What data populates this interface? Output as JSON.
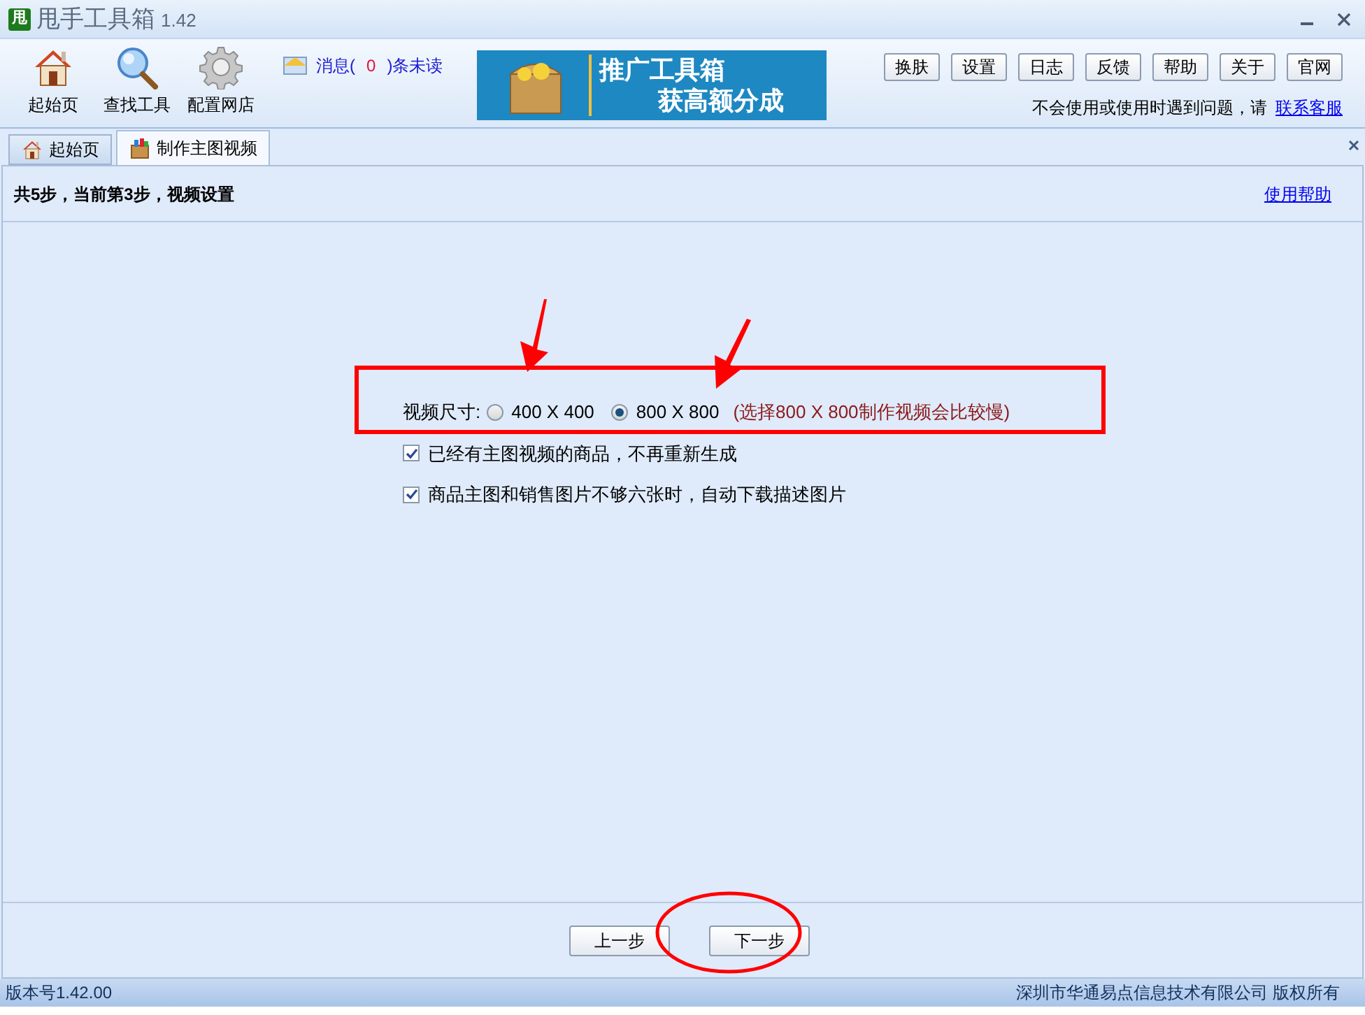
{
  "window": {
    "title": "甩手工具箱",
    "version": "1.42",
    "app_icon": "甩"
  },
  "toolbar": [
    {
      "label": "起始页",
      "kind": "home"
    },
    {
      "label": "查找工具",
      "kind": "search"
    },
    {
      "label": "配置网店",
      "kind": "gear"
    }
  ],
  "messages": {
    "prefix": "消息(",
    "count": "0",
    "suffix": ")条未读"
  },
  "banner": {
    "line_1": "推广工具箱",
    "line_2": "获高额分成"
  },
  "top_buttons": [
    "换肤",
    "设置",
    "日志",
    "反馈",
    "帮助",
    "关于",
    "官网"
  ],
  "support": {
    "text": "不会使用或使用时遇到问题，请",
    "link": "联系客服"
  },
  "tabs": [
    {
      "label": "起始页",
      "kind": "home",
      "selected": false
    },
    {
      "label": "制作主图视频",
      "kind": "box",
      "selected": true
    }
  ],
  "step_header": {
    "text": "共5步，当前第3步，视频设置",
    "help_link": "使用帮助"
  },
  "video_size": {
    "label": "视频尺寸:",
    "options": [
      {
        "label": "400 X 400",
        "selected": false
      },
      {
        "label": "800 X 800",
        "selected": true
      }
    ],
    "note": "(选择800 X 800制作视频会比较慢)"
  },
  "options": [
    {
      "label": "已经有主图视频的商品，不再重新生成",
      "checked": true
    },
    {
      "label": "商品主图和销售图片不够六张时，自动下载描述图片",
      "checked": true
    }
  ],
  "nav_buttons": [
    "上一步",
    "下一步"
  ],
  "status_bar": {
    "version": "版本号1.42.00",
    "copyright": "深圳市华通易点信息技术有限公司 版权所有"
  }
}
